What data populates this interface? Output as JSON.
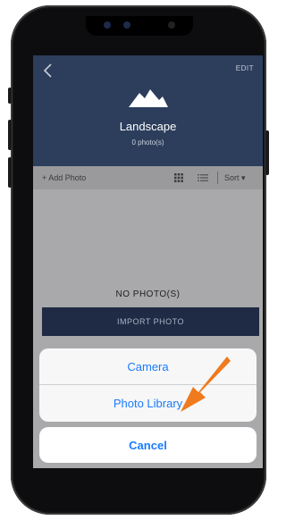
{
  "header": {
    "edit_label": "EDIT",
    "album_title": "Landscape",
    "photo_count": "0 photo(s)"
  },
  "toolbar": {
    "add_photo_label": "+ Add Photo",
    "sort_label": "Sort ▾"
  },
  "empty_state": {
    "message": "NO PHOTO(S)",
    "import_label": "IMPORT PHOTO"
  },
  "action_sheet": {
    "options": [
      "Camera",
      "Photo Library"
    ],
    "cancel_label": "Cancel"
  },
  "colors": {
    "header_bg": "#2c3e5c",
    "accent_blue": "#1a7bff",
    "annotation_arrow": "#f07a1e"
  }
}
